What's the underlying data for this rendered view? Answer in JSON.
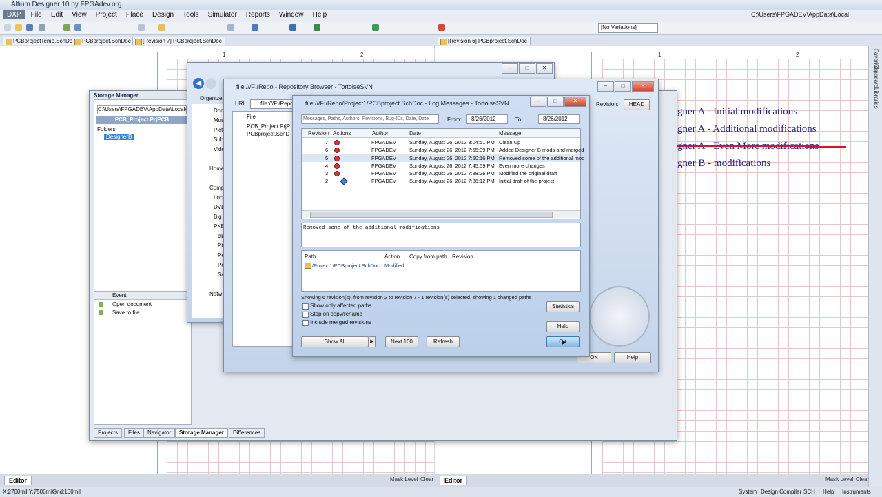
{
  "app": {
    "title": "Altium Designer 10 by FPGAdev.org",
    "menu": [
      "DXP",
      "File",
      "Edit",
      "View",
      "Project",
      "Place",
      "Design",
      "Tools",
      "Simulator",
      "Reports",
      "Window",
      "Help"
    ],
    "path": "C:\\Users\\FPGADEV\\AppData\\Local",
    "variations": "[No Variations]"
  },
  "doc_tabs": [
    "PCBprojectTemp.SchDoc",
    "PCBproject.SchDoc *",
    "[Revision 7] PCBproject.SchDoc",
    "[Revision 6] PCBproject.SchDoc"
  ],
  "ruler": {
    "left": [
      "1",
      "2"
    ],
    "right": [
      "1",
      "2"
    ]
  },
  "schematic_notes": [
    "gner A - Initial modifications",
    "gner A - Additional modifications",
    "gner A - Even More modifications",
    "gner B - modifications"
  ],
  "right_panels": [
    "Favorites",
    "Clipboard",
    "Libraries"
  ],
  "storage_manager": {
    "title": "Storage Manager",
    "path": "C:\\Users\\FPGADEV\\AppData\\Local\\T",
    "project": "PCB_Project.PrjPCB",
    "folders_label": "Folders",
    "folder": "DesignerB",
    "event_header": "Event",
    "events": [
      "Open document",
      "Save to file"
    ],
    "tabs": [
      "Projects",
      "Files",
      "Navigator",
      "Storage Manager",
      "Differences"
    ]
  },
  "explorer": {
    "organize": "Organize",
    "nav": [
      "Doc",
      "Mus",
      "Pict",
      "Sub",
      "Vide",
      "Home",
      "Comp",
      "Loc",
      "DVD",
      "Big",
      "PKB",
      "cli",
      "PC",
      "Pe",
      "Pe",
      "Sa",
      "Netw"
    ]
  },
  "repo_browser": {
    "title": "file:///F:/Repo - Repository Browser - TortoiseSVN",
    "url_label": "URL:",
    "url": "file:///F:/Repo",
    "file_header": "File",
    "files": [
      "PCB_Project.PrjP",
      "PCBproject.SchD"
    ],
    "revision_label": "Revision:",
    "revision_value": "HEAD",
    "ok": "OK",
    "help": "Help"
  },
  "log": {
    "title": "file:///F:/Repo/Project1/PCBproject.SchDoc - Log Messages - TortoiseSVN",
    "filter_placeholder": "Messages, Paths, Authors, Revisions, Bug-IDs, Date, Date",
    "from_label": "From:",
    "from": "8/26/2012",
    "to_label": "To:",
    "to": "8/26/2012",
    "columns": [
      "Revision",
      "Actions",
      "Author",
      "Date",
      "Message"
    ],
    "rows": [
      {
        "rev": "7",
        "author": "FPGADEV",
        "date": "Sunday, August 26, 2012 8:04:51 PM",
        "msg": "Clean Up"
      },
      {
        "rev": "6",
        "author": "FPGADEV",
        "date": "Sunday, August 26, 2012 7:55:09 PM",
        "msg": "Added Designer B mods and merged"
      },
      {
        "rev": "5",
        "author": "FPGADEV",
        "date": "Sunday, August 26, 2012 7:50:16 PM",
        "msg": "Removed some of the additional mod"
      },
      {
        "rev": "4",
        "author": "FPGADEV",
        "date": "Sunday, August 26, 2012 7:45:59 PM",
        "msg": "Even more changes"
      },
      {
        "rev": "3",
        "author": "FPGADEV",
        "date": "Sunday, August 26, 2012 7:38:26 PM",
        "msg": "Modified the original draft"
      },
      {
        "rev": "2",
        "author": "FPGADEV",
        "date": "Sunday, August 26, 2012 7:36:12 PM",
        "msg": "Initial draft of the project"
      }
    ],
    "message": "Removed some of the additional modifications",
    "path_columns": [
      "Path",
      "Action",
      "Copy from path",
      "Revision"
    ],
    "path_row": {
      "path": "/Project1/PCBproject.SchDoc",
      "action": "Modified"
    },
    "summary": "Showing 6 revision(s), from revision 2 to revision 7 - 1 revision(s) selected, showing 1 changed paths",
    "options": [
      "Show only affected paths",
      "Stop on copy/rename",
      "Include merged revisions"
    ],
    "buttons": {
      "show_all": "Show All",
      "next": "Next 100",
      "refresh": "Refresh",
      "statistics": "Statistics",
      "help": "Help",
      "ok": "OK"
    }
  },
  "status": {
    "coords": "X:2700mil Y:7500mil",
    "grid": "Grid:100mil",
    "editor": "Editor",
    "mask": "Mask Level",
    "clear": "Clear",
    "items": [
      "System",
      "Design Compiler",
      "SCH",
      "Help",
      "Instruments"
    ]
  }
}
